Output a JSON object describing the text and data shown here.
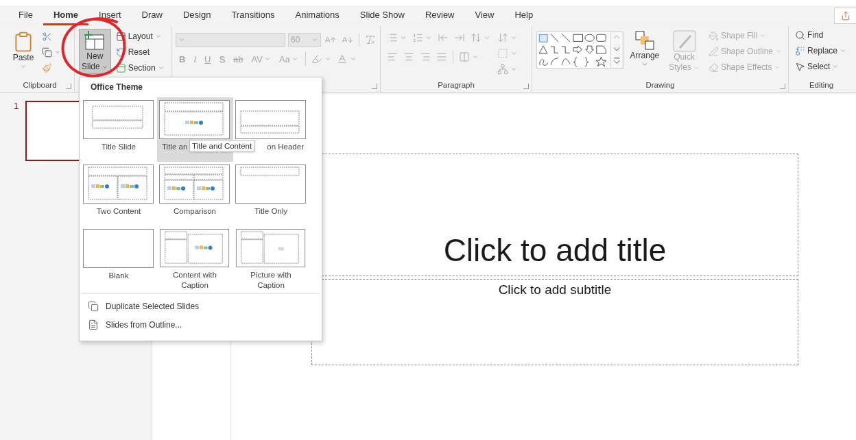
{
  "tabs": [
    {
      "label": "File",
      "selected": false
    },
    {
      "label": "Home",
      "selected": true
    },
    {
      "label": "Insert",
      "selected": false
    },
    {
      "label": "Draw",
      "selected": false
    },
    {
      "label": "Design",
      "selected": false
    },
    {
      "label": "Transitions",
      "selected": false
    },
    {
      "label": "Animations",
      "selected": false
    },
    {
      "label": "Slide Show",
      "selected": false
    },
    {
      "label": "Review",
      "selected": false
    },
    {
      "label": "View",
      "selected": false
    },
    {
      "label": "Help",
      "selected": false
    }
  ],
  "ribbon": {
    "clipboard": {
      "paste": "Paste",
      "label": "Clipboard"
    },
    "slides": {
      "new_slide": "New",
      "new_slide_2": "Slide",
      "layout": "Layout",
      "reset": "Reset",
      "section": "Section",
      "pressed": true
    },
    "font": {
      "size": "60",
      "format_buttons": [
        "B",
        "I",
        "U",
        "S",
        "ab",
        "AV",
        "Aa"
      ],
      "disabled": true
    },
    "paragraph": {
      "label": "Paragraph",
      "disabled": true
    },
    "drawing": {
      "arrange": "Arrange",
      "quick_styles": "Quick",
      "quick_styles_2": "Styles",
      "quick_styles_disabled": true,
      "shape_commands": [
        {
          "label": "Shape Fill",
          "kind": "fill",
          "disabled": true
        },
        {
          "label": "Shape Outline",
          "kind": "outline",
          "disabled": true
        },
        {
          "label": "Shape Effects",
          "kind": "effects",
          "disabled": true
        }
      ],
      "label": "Drawing"
    },
    "editing": {
      "find": "Find",
      "replace": "Replace",
      "select": "Select",
      "label": "Editing"
    }
  },
  "slide_pane": {
    "slides": [
      {
        "number": "1",
        "selected": true
      }
    ]
  },
  "slide": {
    "title_placeholder": "Click to add title",
    "subtitle_placeholder": "Click to add subtitle"
  },
  "layout_menu": {
    "heading": "Office Theme",
    "layouts": [
      {
        "label": "Title Slide",
        "kind": "title",
        "selected": false
      },
      {
        "label": "Title an",
        "kind": "content",
        "selected": true,
        "tooltip": "Title and Content"
      },
      {
        "label": "on Header",
        "kind": "section",
        "selected": false
      },
      {
        "label": "Two Content",
        "kind": "two",
        "selected": false
      },
      {
        "label": "Comparison",
        "kind": "comparison",
        "selected": false
      },
      {
        "label": "Title Only",
        "kind": "titleonly",
        "selected": false
      },
      {
        "label": "Blank",
        "kind": "blank",
        "selected": false
      },
      {
        "label": "Content with Caption",
        "kind": "contentcaption",
        "selected": false
      },
      {
        "label": "Picture with Caption",
        "kind": "picturecaption",
        "selected": false
      }
    ],
    "commands": [
      {
        "label": "Duplicate Selected Slides",
        "kind": "duplicate"
      },
      {
        "label": "Slides from Outline...",
        "kind": "outline"
      }
    ]
  }
}
